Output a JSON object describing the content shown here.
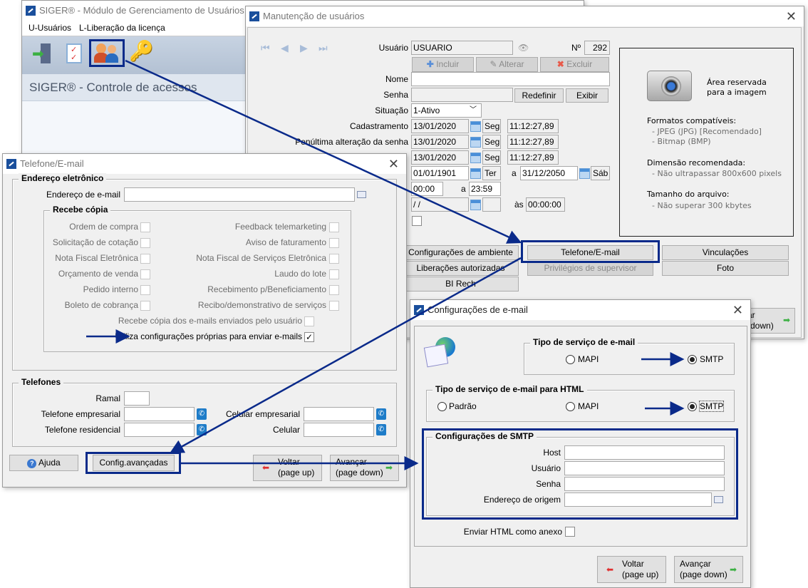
{
  "main_window": {
    "title": "SIGER® - Módulo de Gerenciamento de Usuários e ace",
    "menu": [
      "U-Usuários",
      "L-Liberação da licença"
    ],
    "toolbar_icons": [
      "exit-door-icon",
      "checklist-icon",
      "users-icon",
      "key-icon"
    ],
    "header": "SIGER® - Controle de acessos"
  },
  "maint": {
    "title": "Manutenção de usuários",
    "usuario_label": "Usuário",
    "usuario_value": "USUARIO",
    "numero_label": "Nº",
    "numero_value": "292",
    "incluir": "Incluir",
    "alterar": "Alterar",
    "excluir": "Excluir",
    "nome_label": "Nome",
    "nome_value": "",
    "senha_label": "Senha",
    "redefinir": "Redefinir",
    "exibir": "Exibir",
    "situacao_label": "Situação",
    "situacao_value": "1-Ativo",
    "rows": [
      {
        "label": "Cadastramento",
        "date": "13/01/2020",
        "day": "Seg",
        "time": "11:12:27,89"
      },
      {
        "label": "Penúltima alteração da senha",
        "date": "13/01/2020",
        "day": "Seg",
        "time": "11:12:27,89"
      },
      {
        "label": "",
        "date": "13/01/2020",
        "day": "Seg",
        "time": "11:12:27,89"
      }
    ],
    "validity": {
      "from": "01/01/1901",
      "from_day": "Ter",
      "a": "a",
      "to": "31/12/2050",
      "to_day": "Sáb"
    },
    "hours": {
      "from": "00:00",
      "a": "a",
      "to": "23:59"
    },
    "last": {
      "date": " /  /",
      "as": "às",
      "time": "00:00:00"
    },
    "buttons": {
      "config_ambiente": "Configurações de ambiente",
      "liberacoes": "Liberações autorizadas",
      "bi_rech": "BI Rech",
      "telefone_email": "Telefone/E-mail",
      "privilegios": "Privilégios de supervisor",
      "vinculacoes": "Vinculações",
      "foto": "Foto",
      "avancar_partial": "çar",
      "avancar_partial2": "e down)"
    },
    "image_panel": {
      "reserved": "Área reservada",
      "reserved2": "para a imagem",
      "formats_title": "Formatos compatíveis:",
      "format1": "- JPEG (JPG) [Recomendado]",
      "format2": "- Bitmap (BMP)",
      "dim_title": "Dimensão recomendada:",
      "dim1": "- Não ultrapassar 800x600 pixels",
      "size_title": "Tamanho do arquivo:",
      "size1": "- Não superar 300 kbytes"
    }
  },
  "phone": {
    "title": "Telefone/E-mail",
    "email_group": "Endereço eletrônico",
    "email_label": "Endereço de e-mail",
    "email_value": "",
    "copy_group": "Recebe cópia",
    "copy_left": [
      "Ordem de compra",
      "Solicitação de cotação",
      "Nota Fiscal Eletrônica",
      "Orçamento de venda",
      "Pedido interno",
      "Boleto de cobrança"
    ],
    "copy_right": [
      "Feedback telemarketing",
      "Aviso de faturamento",
      "Nota Fiscal de Serviços Eletrônica",
      "Laudo do lote",
      "Recebimento p/Beneficiamento",
      "Recibo/demonstrativo de serviços"
    ],
    "copy_user": "Recebe cópia dos e-mails enviados pelo usuário",
    "own_config": "Utiliza configurações próprias para enviar e-mails",
    "own_config_checked": true,
    "phones_group": "Telefones",
    "ramal": "Ramal",
    "tel_emp": "Telefone empresarial",
    "tel_res": "Telefone residencial",
    "cel_emp": "Celular empresarial",
    "cel": "Celular",
    "ajuda": "Ajuda",
    "config_avancadas": "Config.avançadas",
    "voltar": "Voltar",
    "voltar2": "(page up)",
    "avancar": "Avançar",
    "avancar2": "(page down)"
  },
  "email_cfg": {
    "title": "Configurações de e-mail",
    "service_group": "Tipo de serviço de e-mail",
    "mapi": "MAPI",
    "smtp": "SMTP",
    "html_group": "Tipo de serviço de e-mail para HTML",
    "padrao": "Padrão",
    "smtp_group": "Configurações de SMTP",
    "host": "Host",
    "usuario": "Usuário",
    "senha": "Senha",
    "origem": "Endereço de origem",
    "html_attach": "Enviar HTML como anexo",
    "voltar": "Voltar",
    "voltar2": "(page up)",
    "avancar": "Avançar",
    "avancar2": "(page down)"
  },
  "colors": {
    "highlight": "#0a2a8a"
  }
}
